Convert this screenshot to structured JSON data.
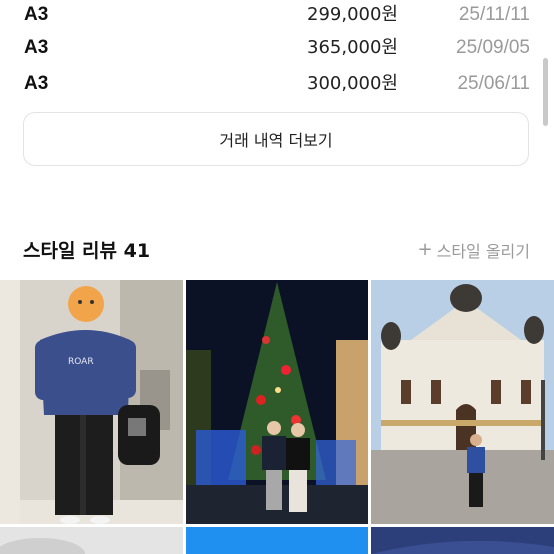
{
  "trades": [
    {
      "size": "A3",
      "price": "299,000원",
      "date": "25/11/11"
    },
    {
      "size": "A3",
      "price": "365,000원",
      "date": "25/09/05"
    },
    {
      "size": "A3",
      "price": "300,000원",
      "date": "25/06/11"
    }
  ],
  "more_button": {
    "label": "거래 내역 더보기"
  },
  "style_review": {
    "title": "스타일 리뷰 41",
    "upload_label": "스타일 올리기",
    "upload_icon": "plus-icon"
  },
  "photos": [
    "review-photo-1",
    "review-photo-2",
    "review-photo-3",
    "review-photo-4",
    "review-photo-5",
    "review-photo-6"
  ],
  "colors": {
    "text": "#111111",
    "muted": "#9a9a9a",
    "border": "#e3e3e3"
  }
}
